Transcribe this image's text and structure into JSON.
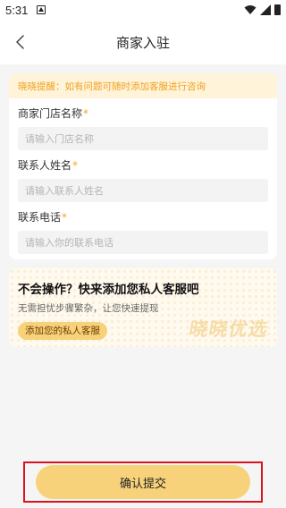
{
  "status_bar": {
    "time": "5:31",
    "icons": [
      "notification-icon",
      "wifi-icon",
      "signal-icon",
      "battery-icon"
    ]
  },
  "header": {
    "title": "商家入驻",
    "back_icon": "chevron-left-icon"
  },
  "form": {
    "tip": "晓晓提醒：如有问题可随时添加客服进行咨询",
    "fields": [
      {
        "label": "商家门店名称",
        "required_mark": "*",
        "placeholder": "请输入门店名称",
        "value": ""
      },
      {
        "label": "联系人姓名",
        "required_mark": "*",
        "placeholder": "请输入联系人姓名",
        "value": ""
      },
      {
        "label": "联系电话",
        "required_mark": "*",
        "placeholder": "请输入你的联系电话",
        "value": ""
      }
    ]
  },
  "promo": {
    "heading": "不会操作？快来添加您私人客服吧",
    "subtext": "无需担忧步骤繁杂，让您快速提现",
    "button_label": "添加您的私人客服",
    "watermark": "晓晓优选"
  },
  "footer": {
    "submit_label": "确认提交"
  },
  "colors": {
    "accent": "#f8d27a",
    "tip_text": "#f0a020",
    "tip_bg": "#fff4d9",
    "highlight": "#d9141e",
    "background": "#f5f5f5"
  }
}
